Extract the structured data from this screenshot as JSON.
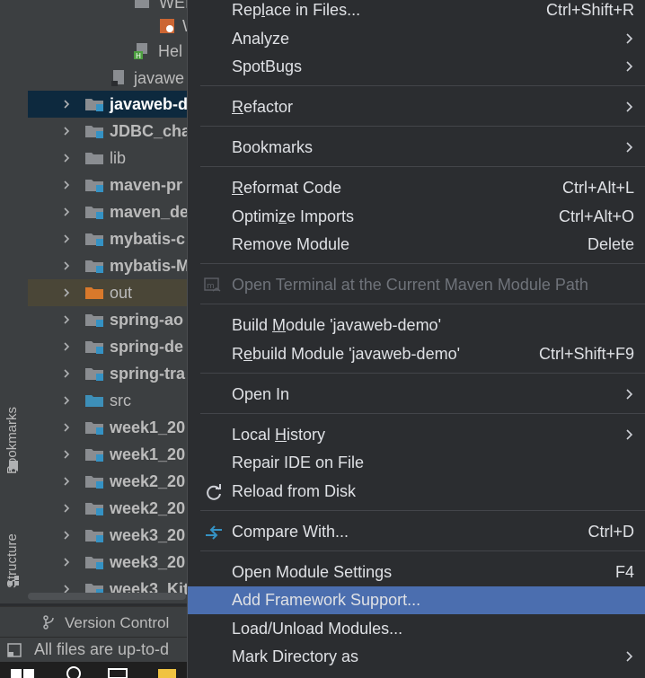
{
  "sidebar": {
    "bookmarks_label": "Bookmarks",
    "structure_label": "Structure"
  },
  "project_tree": {
    "partial_items": [
      {
        "label": "WEI"
      },
      {
        "label": "W"
      },
      {
        "label": "Hel"
      },
      {
        "label": "javawe"
      }
    ],
    "modules": [
      {
        "label": "javaweb-d",
        "selected": true
      },
      {
        "label": "JDBC_cha"
      },
      {
        "label": "lib",
        "plain": true
      },
      {
        "label": "maven-pr"
      },
      {
        "label": "maven_de"
      },
      {
        "label": "mybatis-c"
      },
      {
        "label": "mybatis-M"
      },
      {
        "label": "out",
        "plain": true,
        "excluded": true
      },
      {
        "label": "spring-ao"
      },
      {
        "label": "spring-de"
      },
      {
        "label": "spring-tra"
      },
      {
        "label": "src",
        "plain": true,
        "source": true
      },
      {
        "label": "week1_20"
      },
      {
        "label": "week1_20"
      },
      {
        "label": "week2_20"
      },
      {
        "label": "week2_20"
      },
      {
        "label": "week3_20"
      },
      {
        "label": "week3_20"
      },
      {
        "label": "week3_Kit"
      }
    ]
  },
  "bottom": {
    "version_control_label": "Version Control",
    "status_text": "All files are up-to-d"
  },
  "context_menu": {
    "items": [
      {
        "label": "Replace in Files...",
        "mnemonic_pre": "Rep",
        "mnemonic": "l",
        "mnemonic_post": "ace in Files...",
        "shortcut": "Ctrl+Shift+R"
      },
      {
        "label": "Analyze",
        "submenu": true
      },
      {
        "label": "SpotBugs",
        "submenu": true
      },
      {
        "label": "Refactor",
        "mnemonic_pre": "",
        "mnemonic": "R",
        "mnemonic_post": "efactor",
        "submenu": true
      },
      {
        "label": "Bookmarks",
        "submenu": true
      },
      {
        "label": "Reformat Code",
        "mnemonic_pre": "",
        "mnemonic": "R",
        "mnemonic_post": "eformat Code",
        "shortcut": "Ctrl+Alt+L"
      },
      {
        "label": "Optimize Imports",
        "mnemonic_pre": "Optimi",
        "mnemonic": "z",
        "mnemonic_post": "e Imports",
        "shortcut": "Ctrl+Alt+O"
      },
      {
        "label": "Remove Module",
        "shortcut": "Delete"
      },
      {
        "label": "Open Terminal at the Current Maven Module Path",
        "disabled": true,
        "icon": "terminal-icon"
      },
      {
        "label": "Build Module 'javaweb-demo'",
        "mnemonic_pre": "Build ",
        "mnemonic": "M",
        "mnemonic_post": "odule 'javaweb-demo'"
      },
      {
        "label": "Rebuild Module 'javaweb-demo'",
        "mnemonic_pre": "R",
        "mnemonic": "e",
        "mnemonic_post": "build Module 'javaweb-demo'",
        "shortcut": "Ctrl+Shift+F9"
      },
      {
        "label": "Open In",
        "submenu": true
      },
      {
        "label": "Local History",
        "mnemonic_pre": "Local ",
        "mnemonic": "H",
        "mnemonic_post": "istory",
        "submenu": true
      },
      {
        "label": "Repair IDE on File"
      },
      {
        "label": "Reload from Disk",
        "icon": "reload-icon"
      },
      {
        "label": "Compare With...",
        "shortcut": "Ctrl+D",
        "icon": "compare-icon"
      },
      {
        "label": "Open Module Settings",
        "shortcut": "F4"
      },
      {
        "label": "Add Framework Support...",
        "hover": true
      },
      {
        "label": "Load/Unload Modules..."
      },
      {
        "label": "Mark Directory as",
        "submenu": true
      }
    ]
  },
  "colors": {
    "menu_bg": "#2b2d30",
    "hover_bg": "#4b6eaf",
    "selected_row_bg": "#0d293e",
    "module_badge": "#3592c4"
  }
}
